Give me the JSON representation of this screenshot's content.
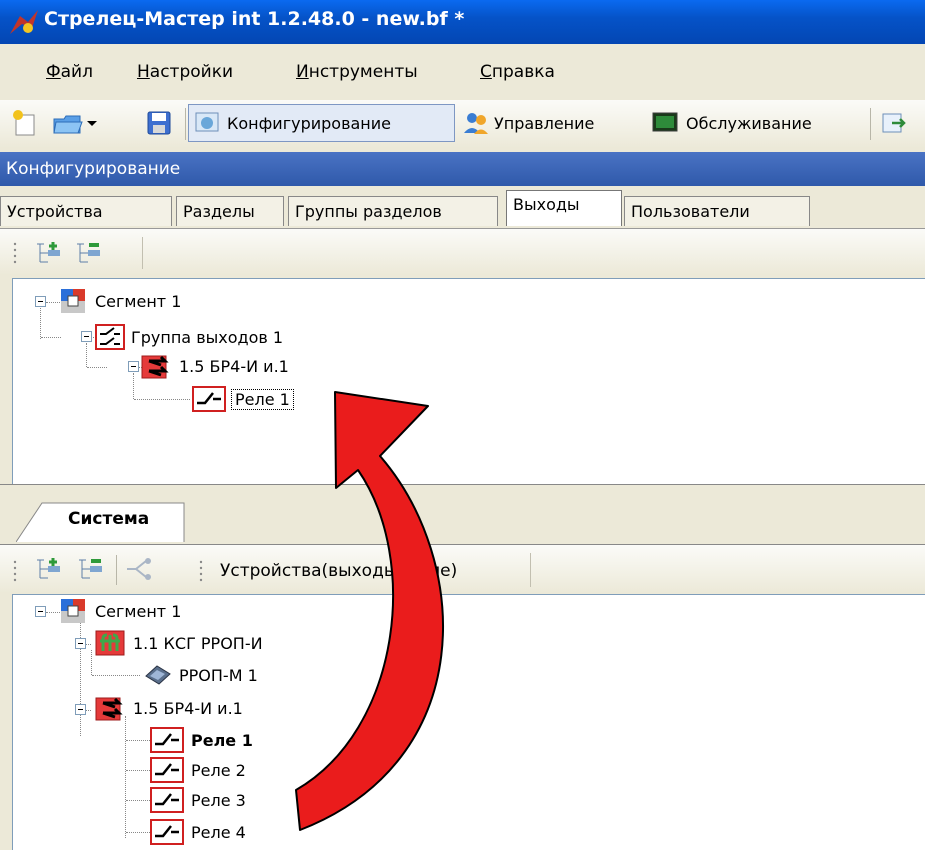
{
  "window": {
    "title": "Стрелец-Мастер int 1.2.48.0 - new.bf *"
  },
  "menu": [
    "Файл",
    "Настройки",
    "Инструменты",
    "Справка"
  ],
  "toolbar": {
    "configure": "Конфигурирование",
    "manage": "Управление",
    "service": "Обслуживание"
  },
  "section": {
    "title": "Конфигурирование"
  },
  "tabs": [
    "Устройства",
    "Разделы",
    "Группы разделов",
    "Выходы",
    "Пользователи"
  ],
  "outputs_tree": {
    "segment": "Сегмент 1",
    "group": "Группа выходов 1",
    "device": "1.5 БР4-И и.1",
    "relay": "Реле 1"
  },
  "system_panel": {
    "tab": "Система",
    "filter_label": "Устройства(выходы, реле)",
    "tree": {
      "segment": "Сегмент 1",
      "ksg": "1.1 КСГ РРОП-И",
      "rrop": "РРОП-М 1",
      "device": "1.5 БР4-И и.1",
      "relays": [
        "Реле 1",
        "Реле 2",
        "Реле 3",
        "Реле 4"
      ]
    }
  }
}
